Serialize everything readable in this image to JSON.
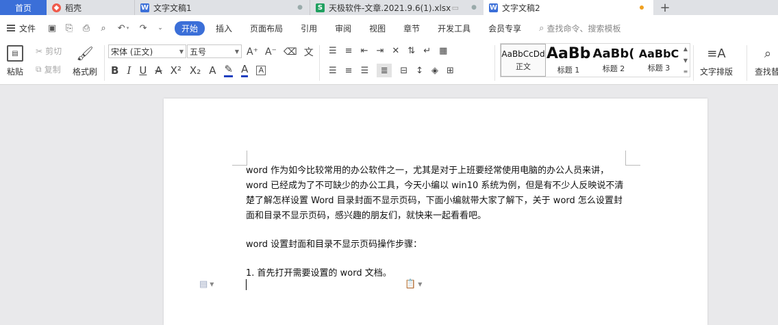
{
  "tabs": [
    {
      "label": "首页"
    },
    {
      "label": "稻壳"
    },
    {
      "label": "文字文稿1"
    },
    {
      "label": "天极软件-文章.2021.9.6(1).xlsx"
    },
    {
      "label": "文字文稿2"
    }
  ],
  "tab_plus": "+",
  "menu": {
    "file": "文件",
    "start": "开始",
    "items": [
      "插入",
      "页面布局",
      "引用",
      "审阅",
      "视图",
      "章节",
      "开发工具",
      "会员专享"
    ],
    "search_placeholder": "查找命令、搜索模板"
  },
  "ribbon": {
    "paste": "粘贴",
    "cut": "剪切",
    "copy": "复制",
    "format_painter": "格式刷",
    "font_name": "宋体 (正文)",
    "font_size": "五号",
    "styles": [
      {
        "preview": "AaBbCcDd",
        "name": "正文"
      },
      {
        "preview": "AaBb",
        "name": "标题 1"
      },
      {
        "preview": "AaBb(",
        "name": "标题 2"
      },
      {
        "preview": "AaBbC",
        "name": "标题 3"
      }
    ],
    "text_layout": "文字排版",
    "find_replace": "查找替"
  },
  "document": {
    "paragraphs": [
      "word 作为如今比较常用的办公软件之一，尤其是对于上班要经常使用电脑的办公人员来讲，word 已经成为了不可缺少的办公工具，今天小编以 win10 系统为例，但是有不少人反映说不清楚了解怎样设置 Word 目录封面不显示页码，下面小编就带大家了解下，关于 word 怎么设置封面和目录不显示页码，感兴趣的朋友们，就快来一起看看吧。",
      "word 设置封面和目录不显示页码操作步骤：",
      "1. 首先打开需要设置的 word 文档。"
    ]
  },
  "colors": {
    "accent": "#3b6fd8",
    "tab_bar": "#dfe1e5",
    "canvas": "#e9e9eb",
    "unsaved_dot": "#f0a020"
  }
}
